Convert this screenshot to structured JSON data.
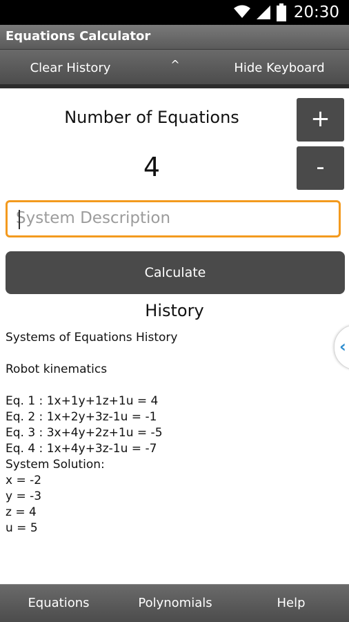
{
  "status_bar": {
    "time": "20:30",
    "icons": [
      "wifi-icon",
      "signal-icon",
      "battery-icon"
    ]
  },
  "app": {
    "title": "Equations Calculator"
  },
  "action_bar": {
    "clear_history": "Clear History",
    "collapse": "^",
    "hide_keyboard": "Hide Keyboard"
  },
  "equations": {
    "label": "Number of Equations",
    "count": "4",
    "increment": "+",
    "decrement": "-"
  },
  "description": {
    "placeholder": "System Description",
    "value": ""
  },
  "calculate_label": "Calculate",
  "history": {
    "title": "History",
    "heading": "Systems of Equations History",
    "system_name": "Robot kinematics",
    "equations": [
      "Eq. 1 : 1x+1y+1z+1u = 4",
      "Eq. 2 : 1x+2y+3z-1u = -1",
      "Eq. 3 : 3x+4y+2z+1u = -5",
      "Eq. 4 : 1x+4y+3z-1u = -7"
    ],
    "solution_label": "System Solution:",
    "solutions": [
      "x = -2",
      "y = -3",
      "z = 4",
      "u = 5"
    ]
  },
  "side_tab_icon": "chevron-left-icon",
  "bottom_nav": {
    "equations": "Equations",
    "polynomials": "Polynomials",
    "help": "Help"
  },
  "colors": {
    "accent_orange": "#f39a1e",
    "button_gray": "#4a4a4a",
    "side_tab_blue": "#2f8ecf"
  }
}
